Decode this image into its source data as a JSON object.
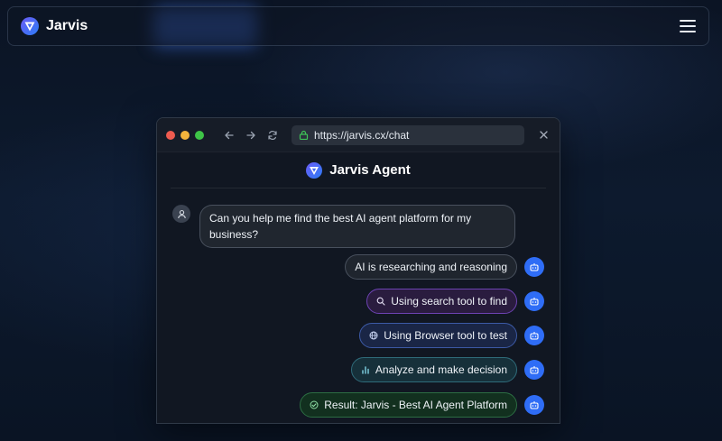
{
  "app": {
    "name": "Jarvis"
  },
  "window": {
    "url": "https://jarvis.cx/chat",
    "traffic_lights": [
      "#ee5b4f",
      "#f3b43c",
      "#3ec447"
    ]
  },
  "chat": {
    "title": "Jarvis Agent",
    "user_message": "Can you help me find the best AI agent platform for my business?",
    "steps": [
      {
        "label": "AI is researching and reasoning",
        "icon": "none"
      },
      {
        "label": "Using search tool to find",
        "icon": "search-icon"
      },
      {
        "label": "Using Browser tool to test",
        "icon": "globe-icon"
      },
      {
        "label": "Analyze and make decision",
        "icon": "bar-chart-icon"
      },
      {
        "label": "Result: Jarvis - Best AI Agent Platform",
        "icon": "check-circle-icon"
      }
    ]
  },
  "colors": {
    "accent": "#2f6df6",
    "background": "#0a1220"
  }
}
